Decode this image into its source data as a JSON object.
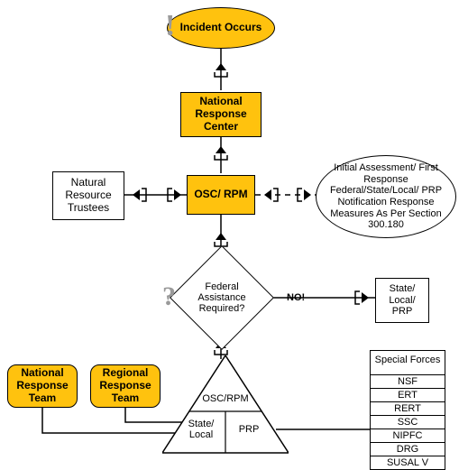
{
  "nodes": {
    "start": "Incident Occurs",
    "nrc": "National Response Center",
    "nrt": "Natural Resource Trustees",
    "osc": "OSC/ RPM",
    "ia": "Initial Assessment/ First Response Federal/State/Local/ PRP Notification Response Measures As Per Section 300.180",
    "decision": "Federal Assistance Required?",
    "no_label": "NO!",
    "slp": "State/ Local/ PRP",
    "nrt2": "National Response Team",
    "rrt": "Regional Response Team",
    "pyr_top": "OSC/RPM",
    "pyr_bl": "State/ Local",
    "pyr_br": "PRP",
    "sf_header": "Special Forces"
  },
  "special_forces": [
    "NSF",
    "ERT",
    "RERT",
    "SSC",
    "NIPFC",
    "DRG",
    "SUSAL V"
  ],
  "colors": {
    "highlight": "#ffc20e"
  },
  "chart_data": {
    "type": "flowchart",
    "nodes": [
      {
        "id": "start",
        "label": "Incident Occurs",
        "shape": "ellipse",
        "highlight": true
      },
      {
        "id": "nrc",
        "label": "National Response Center",
        "shape": "rect",
        "highlight": true
      },
      {
        "id": "nrt",
        "label": "Natural Resource Trustees",
        "shape": "rect",
        "highlight": false
      },
      {
        "id": "osc",
        "label": "OSC/RPM",
        "shape": "rect",
        "highlight": true
      },
      {
        "id": "ia",
        "label": "Initial Assessment/First Response Federal/State/Local/PRP Notification Response Measures As Per Section 300.180",
        "shape": "ellipse",
        "highlight": false
      },
      {
        "id": "dec",
        "label": "Federal Assistance Required?",
        "shape": "diamond",
        "highlight": false
      },
      {
        "id": "slp",
        "label": "State/Local/PRP",
        "shape": "rect",
        "highlight": false
      },
      {
        "id": "nrt2",
        "label": "National Response Team",
        "shape": "rounded",
        "highlight": true
      },
      {
        "id": "rrt",
        "label": "Regional Response Team",
        "shape": "rounded",
        "highlight": true
      },
      {
        "id": "pyr",
        "label": "OSC/RPM | State/Local | PRP",
        "shape": "triangle",
        "highlight": false
      },
      {
        "id": "sf",
        "label": "Special Forces",
        "shape": "table",
        "highlight": false,
        "items": [
          "NSF",
          "ERT",
          "RERT",
          "SSC",
          "NIPFC",
          "DRG",
          "SUSAL V"
        ]
      }
    ],
    "edges": [
      {
        "from": "start",
        "to": "nrc",
        "style": "solid"
      },
      {
        "from": "nrc",
        "to": "osc",
        "style": "solid"
      },
      {
        "from": "osc",
        "to": "nrt",
        "style": "solid",
        "dir": "both"
      },
      {
        "from": "osc",
        "to": "ia",
        "style": "dashed",
        "dir": "both"
      },
      {
        "from": "osc",
        "to": "dec",
        "style": "solid"
      },
      {
        "from": "dec",
        "to": "slp",
        "style": "solid",
        "label": "NO!"
      },
      {
        "from": "dec",
        "to": "pyr",
        "style": "solid"
      },
      {
        "from": "nrt2",
        "to": "pyr",
        "style": "solid"
      },
      {
        "from": "rrt",
        "to": "pyr",
        "style": "solid"
      },
      {
        "from": "pyr",
        "to": "sf",
        "style": "solid"
      }
    ]
  }
}
